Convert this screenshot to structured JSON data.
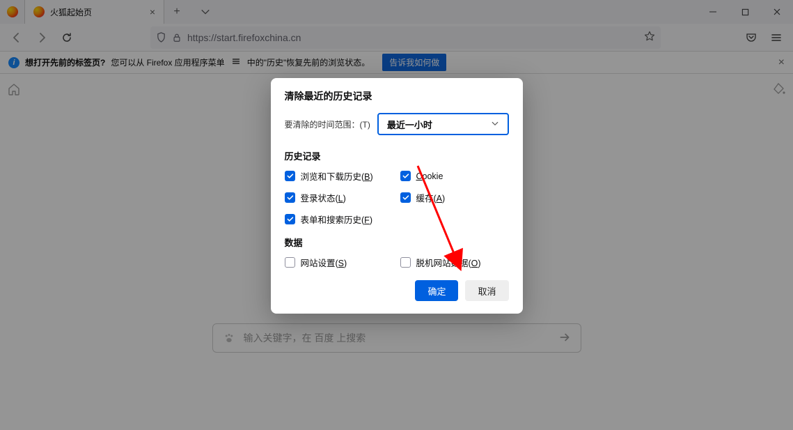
{
  "tab": {
    "title": "火狐起始页"
  },
  "url": "https://start.firefoxchina.cn",
  "infobar": {
    "bold": "想打开先前的标签页?",
    "text1": "您可以从 Firefox 应用程序菜单",
    "text2": "中的\"历史\"恢复先前的浏览状态。",
    "cta": "告诉我如何做"
  },
  "search": {
    "placeholder": "输入关键字，在 百度 上搜索"
  },
  "dialog": {
    "title": "清除最近的历史记录",
    "range_label": "要清除的时间范围：",
    "range_hotkey": "(T)",
    "range_value": "最近一小时",
    "section_history": "历史记录",
    "section_data": "数据",
    "checks": {
      "browseDownload_pre": "浏览和下载历史(",
      "browseDownload_key": "B",
      "browseDownload_post": ")",
      "cookie_key": "C",
      "cookie_post": "ookie",
      "login_pre": "登录状态(",
      "login_key": "L",
      "login_post": ")",
      "cache_pre": "缓存(",
      "cache_key": "A",
      "cache_post": ")",
      "form_pre": "表单和搜索历史(",
      "form_key": "F",
      "form_post": ")",
      "site_pre": "网站设置(",
      "site_key": "S",
      "site_post": ")",
      "offline_pre": "脱机网站数据(",
      "offline_key": "O",
      "offline_post": ")"
    },
    "ok": "确定",
    "cancel": "取消"
  }
}
